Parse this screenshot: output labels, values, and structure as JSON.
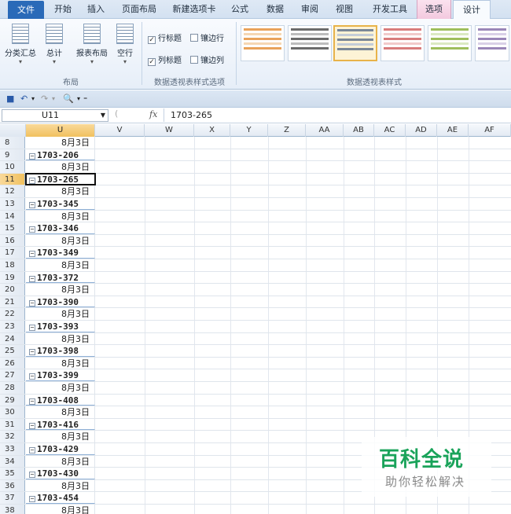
{
  "tabs": [
    "文件",
    "开始",
    "插入",
    "页面布局",
    "新建选项卡",
    "公式",
    "数据",
    "审阅",
    "视图",
    "开发工具",
    "选项",
    "设计"
  ],
  "ribbon": {
    "layout_group": {
      "buttons": [
        "分类汇总",
        "总计",
        "报表布局",
        "空行"
      ],
      "label": "布局"
    },
    "options_group": {
      "checkboxes": [
        {
          "label": "行标题",
          "checked": true
        },
        {
          "label": "镶边行",
          "checked": false
        },
        {
          "label": "列标题",
          "checked": true
        },
        {
          "label": "镶边列",
          "checked": false
        }
      ],
      "label": "数据透视表样式选项"
    },
    "styles_group": {
      "label": "数据透视表样式"
    }
  },
  "formula_bar": {
    "name_box": "U11",
    "fx": "fx",
    "value": "1703-265"
  },
  "columns": [
    "U",
    "V",
    "W",
    "X",
    "Y",
    "Z",
    "AA",
    "AB",
    "AC",
    "AD",
    "AE",
    "AF"
  ],
  "rows": [
    {
      "n": "8",
      "u": "8月3日",
      "type": "date"
    },
    {
      "n": "9",
      "u": "1703-206",
      "type": "group"
    },
    {
      "n": "10",
      "u": "8月3日",
      "type": "date"
    },
    {
      "n": "11",
      "u": "1703-265",
      "type": "group",
      "active": true
    },
    {
      "n": "12",
      "u": "8月3日",
      "type": "date"
    },
    {
      "n": "13",
      "u": "1703-345",
      "type": "group"
    },
    {
      "n": "14",
      "u": "8月3日",
      "type": "date"
    },
    {
      "n": "15",
      "u": "1703-346",
      "type": "group"
    },
    {
      "n": "16",
      "u": "8月3日",
      "type": "date"
    },
    {
      "n": "17",
      "u": "1703-349",
      "type": "group"
    },
    {
      "n": "18",
      "u": "8月3日",
      "type": "date"
    },
    {
      "n": "19",
      "u": "1703-372",
      "type": "group"
    },
    {
      "n": "20",
      "u": "8月3日",
      "type": "date"
    },
    {
      "n": "21",
      "u": "1703-390",
      "type": "group"
    },
    {
      "n": "22",
      "u": "8月3日",
      "type": "date"
    },
    {
      "n": "23",
      "u": "1703-393",
      "type": "group"
    },
    {
      "n": "24",
      "u": "8月3日",
      "type": "date"
    },
    {
      "n": "25",
      "u": "1703-398",
      "type": "group"
    },
    {
      "n": "26",
      "u": "8月3日",
      "type": "date"
    },
    {
      "n": "27",
      "u": "1703-399",
      "type": "group"
    },
    {
      "n": "28",
      "u": "8月3日",
      "type": "date"
    },
    {
      "n": "29",
      "u": "1703-408",
      "type": "group"
    },
    {
      "n": "30",
      "u": "8月3日",
      "type": "date"
    },
    {
      "n": "31",
      "u": "1703-416",
      "type": "group"
    },
    {
      "n": "32",
      "u": "8月3日",
      "type": "date"
    },
    {
      "n": "33",
      "u": "1703-429",
      "type": "group"
    },
    {
      "n": "34",
      "u": "8月3日",
      "type": "date"
    },
    {
      "n": "35",
      "u": "1703-430",
      "type": "group"
    },
    {
      "n": "36",
      "u": "8月3日",
      "type": "date"
    },
    {
      "n": "37",
      "u": "1703-454",
      "type": "group"
    },
    {
      "n": "38",
      "u": "8月3日",
      "type": "date"
    }
  ],
  "watermark": {
    "title": "百科全说",
    "subtitle": "助你轻松解决"
  },
  "colors": {
    "file_tab": "#2a6ab8",
    "selection": "#f1c15f",
    "watermark": "#1aa35a"
  }
}
